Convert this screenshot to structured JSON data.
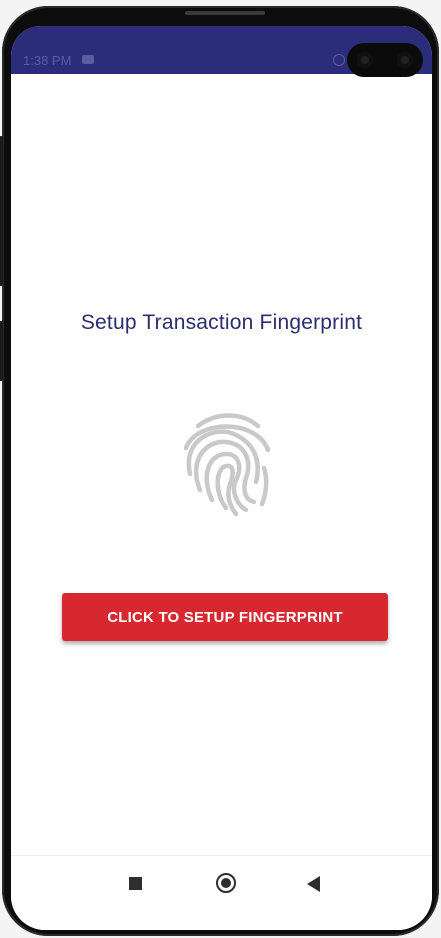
{
  "status_bar": {
    "time": "1:38 PM",
    "message_icon": "message-icon",
    "alarm_icon": "alarm-icon",
    "color": "#2b2d7a"
  },
  "main": {
    "title": "Setup Transaction Fingerprint",
    "fingerprint_icon": "fingerprint-icon",
    "setup_button_label": "CLICK TO SETUP FINGERPRINT",
    "accent_color": "#d8282f"
  },
  "nav_bar": {
    "items": [
      {
        "name": "recents-button",
        "icon": "square-icon"
      },
      {
        "name": "home-button",
        "icon": "circle-icon"
      },
      {
        "name": "back-button",
        "icon": "back-triangle-icon"
      }
    ]
  }
}
